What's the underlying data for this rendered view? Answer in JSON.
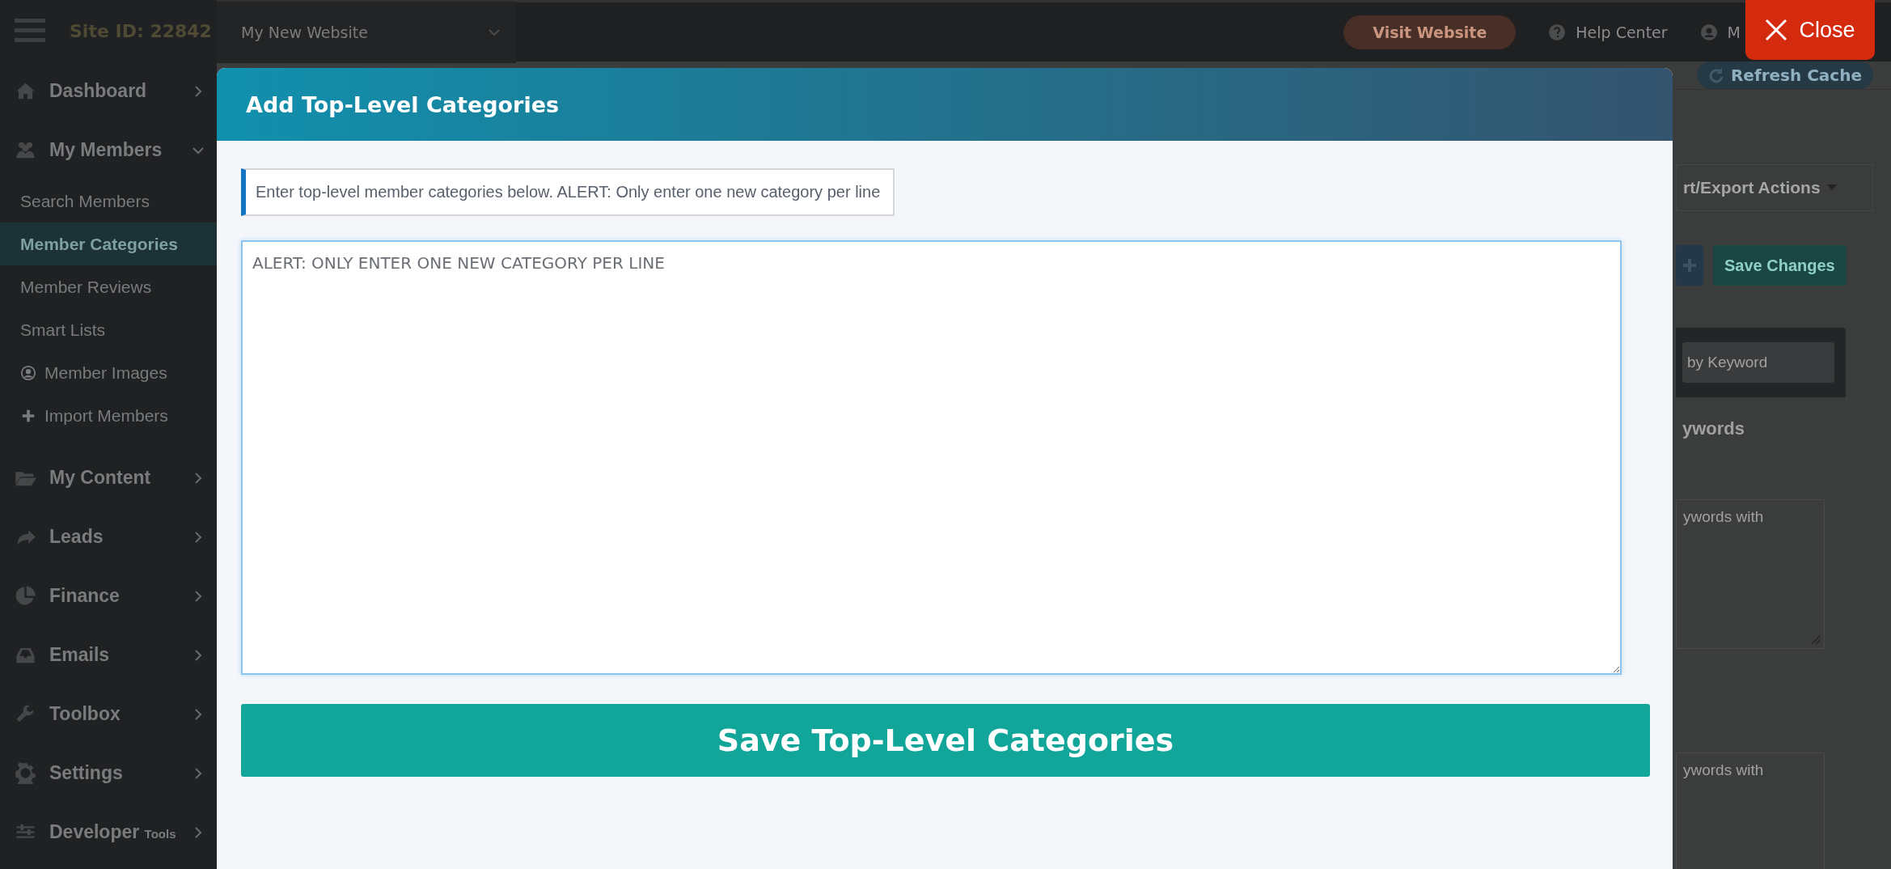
{
  "sidebar": {
    "site_id": "Site ID: 22842",
    "items": [
      {
        "kind": "section",
        "label": "Dashboard",
        "expanded": false
      },
      {
        "kind": "section",
        "label": "My Members",
        "expanded": true,
        "children": [
          {
            "label": "Search Members",
            "selected": false
          },
          {
            "label": "Member Categories",
            "selected": true
          },
          {
            "label": "Member Reviews",
            "selected": false
          },
          {
            "label": "Smart Lists",
            "selected": false
          },
          {
            "label": "Member Images",
            "selected": false,
            "kind": "icon"
          },
          {
            "label": "Import Members",
            "selected": false,
            "kind": "icon"
          }
        ]
      },
      {
        "kind": "section",
        "label": "My Content",
        "expanded": false
      },
      {
        "kind": "section",
        "label": "Leads",
        "expanded": false
      },
      {
        "kind": "section",
        "label": "Finance",
        "expanded": false
      },
      {
        "kind": "section",
        "label": "Emails",
        "expanded": false
      },
      {
        "kind": "section",
        "label": "Toolbox",
        "expanded": false
      },
      {
        "kind": "section",
        "label": "Settings",
        "expanded": false
      },
      {
        "kind": "section",
        "label": "Developer",
        "sublabel": "Tools",
        "expanded": false
      }
    ]
  },
  "topbar": {
    "website_select": "My New Website",
    "visit_button": "Visit Website",
    "help_link": "Help Center",
    "account_link": "M"
  },
  "background": {
    "refresh_button": "Refresh Cache",
    "actions_button": "rt/Export Actions",
    "save_button": "Save Changes",
    "search_placeholder": "by Keyword",
    "panel_heading": "ywords",
    "fields": [
      "ywords with",
      "ywords with"
    ]
  },
  "modal": {
    "title": "Add Top-Level Categories",
    "notice": "Enter top-level member categories below. ALERT: Only enter one new category per line",
    "textarea_placeholder": "ALERT: ONLY ENTER ONE NEW CATEGORY PER LINE",
    "save_button": "Save Top-Level Categories"
  },
  "close_button": "Close"
}
